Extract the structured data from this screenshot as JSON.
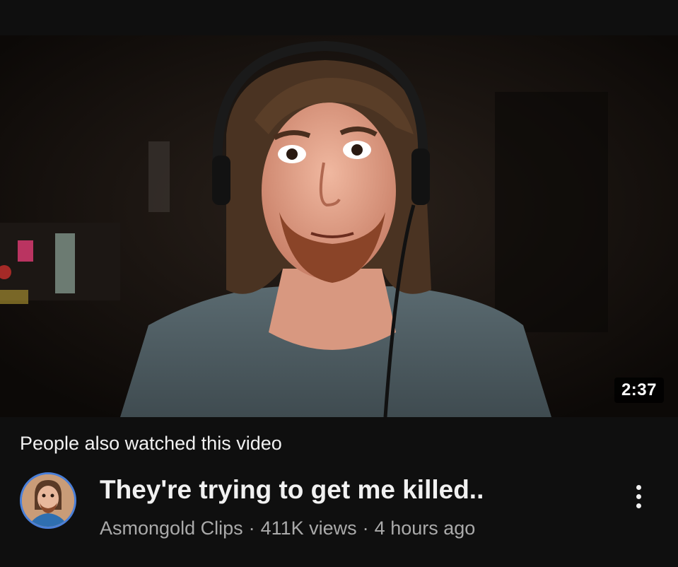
{
  "video": {
    "duration": "2:37",
    "context_label": "People also watched this video",
    "title": "They're trying to get me killed..",
    "channel": "Asmongold Clips",
    "views": "411K views",
    "age": "4 hours ago",
    "separator": "·"
  },
  "icons": {
    "more": "more-vertical-icon",
    "avatar": "channel-avatar"
  },
  "colors": {
    "background": "#0f0f0f",
    "primary_text": "#f1f1f1",
    "secondary_text": "#aaaaaa",
    "avatar_ring": "#4a7fd8"
  }
}
